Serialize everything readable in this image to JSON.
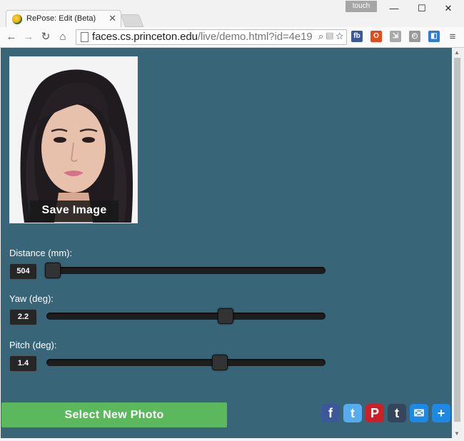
{
  "browser": {
    "tab_title": "RePose: Edit (Beta)",
    "touch_badge": "touch",
    "url_host": "faces.cs.princeton.edu",
    "url_path": "/live/demo.html?id=4e19",
    "window_buttons": {
      "minimize": "—",
      "maximize": "☐",
      "close": "✕"
    },
    "extensions": [
      {
        "name": "fb",
        "label": "fb",
        "color": "#3b5998"
      },
      {
        "name": "office",
        "label": "O",
        "color": "#e64a19"
      },
      {
        "name": "edit",
        "label": "⇲",
        "color": "#aaaaaa"
      },
      {
        "name": "compass",
        "label": "◴",
        "color": "#999999"
      },
      {
        "name": "cast",
        "label": "◧",
        "color": "#2f7bd6"
      }
    ]
  },
  "page": {
    "save_image_label": "Save Image",
    "controls": [
      {
        "label": "Distance (mm):",
        "value": "504",
        "fraction": 0.02
      },
      {
        "label": "Yaw (deg):",
        "value": "2.2",
        "fraction": 0.64
      },
      {
        "label": "Pitch (deg):",
        "value": "1.4",
        "fraction": 0.62
      }
    ],
    "select_photo_label": "Select New Photo",
    "share": [
      {
        "name": "facebook",
        "glyph": "f",
        "color": "#3b5998"
      },
      {
        "name": "twitter",
        "glyph": "t",
        "color": "#55acee"
      },
      {
        "name": "pinterest",
        "glyph": "P",
        "color": "#cb2027"
      },
      {
        "name": "tumblr",
        "glyph": "t",
        "color": "#35465c"
      },
      {
        "name": "email",
        "glyph": "✉",
        "color": "#1e88e5"
      },
      {
        "name": "more",
        "glyph": "+",
        "color": "#1e88e5"
      }
    ]
  }
}
